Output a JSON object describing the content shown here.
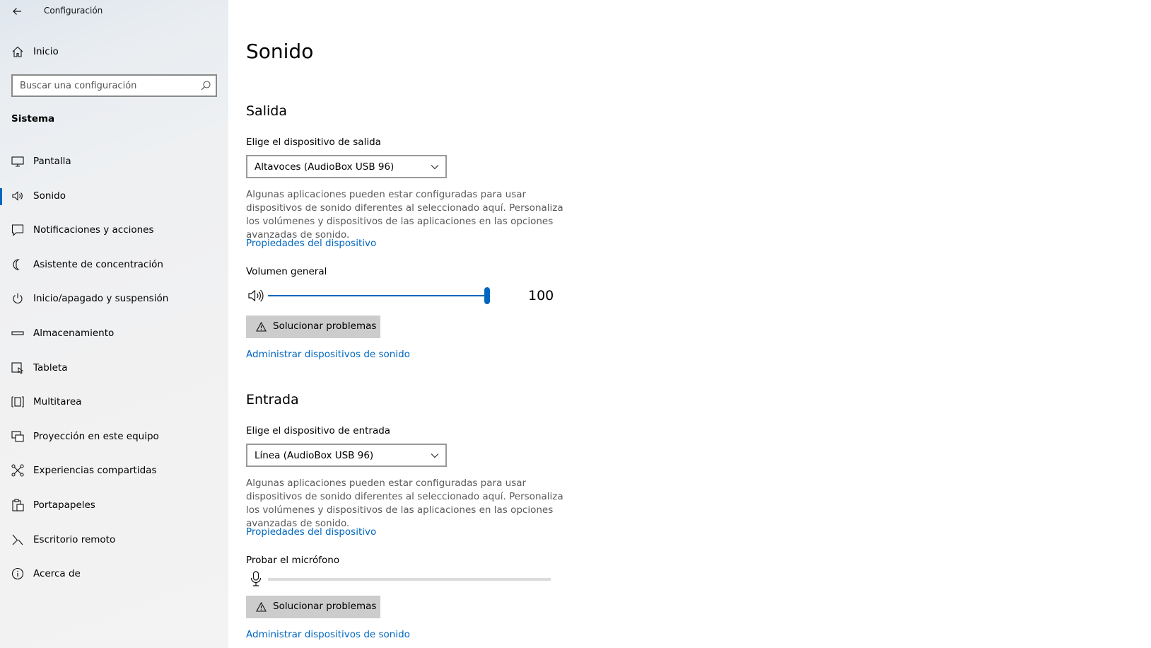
{
  "window": {
    "title": "Configuración"
  },
  "sidebar": {
    "home_label": "Inicio",
    "search_placeholder": "Buscar una configuración",
    "section": "Sistema",
    "items": [
      {
        "label": "Pantalla",
        "icon": "monitor-icon"
      },
      {
        "label": "Sonido",
        "icon": "speaker-icon",
        "active": true
      },
      {
        "label": "Notificaciones y acciones",
        "icon": "notification-icon"
      },
      {
        "label": "Asistente de concentración",
        "icon": "moon-icon"
      },
      {
        "label": "Inicio/apagado y suspensión",
        "icon": "power-icon"
      },
      {
        "label": "Almacenamiento",
        "icon": "storage-icon"
      },
      {
        "label": "Tableta",
        "icon": "tablet-icon"
      },
      {
        "label": "Multitarea",
        "icon": "multitask-icon"
      },
      {
        "label": "Proyección en este equipo",
        "icon": "projection-icon"
      },
      {
        "label": "Experiencias compartidas",
        "icon": "shared-icon"
      },
      {
        "label": "Portapapeles",
        "icon": "clipboard-icon"
      },
      {
        "label": "Escritorio remoto",
        "icon": "remote-desktop-icon"
      },
      {
        "label": "Acerca de",
        "icon": "info-icon"
      }
    ]
  },
  "main": {
    "title": "Sonido",
    "output": {
      "heading": "Salida",
      "device_label": "Elige el dispositivo de salida",
      "device_value": "Altavoces (AudioBox USB 96)",
      "description": "Algunas aplicaciones pueden estar configuradas para usar dispositivos de sonido diferentes al seleccionado aquí. Personaliza los volúmenes y dispositivos de las aplicaciones en las opciones avanzadas de sonido.",
      "properties_link": "Propiedades del dispositivo",
      "volume_label": "Volumen general",
      "volume_value": "100",
      "volume_level": 1.0,
      "troubleshoot": "Solucionar problemas",
      "manage_link": "Administrar dispositivos de sonido"
    },
    "input": {
      "heading": "Entrada",
      "device_label": "Elige el dispositivo de entrada",
      "device_value": "Línea (AudioBox USB 96)",
      "description": "Algunas aplicaciones pueden estar configuradas para usar dispositivos de sonido diferentes al seleccionado aquí. Personaliza los volúmenes y dispositivos de las aplicaciones en las opciones avanzadas de sonido.",
      "properties_link": "Propiedades del dispositivo",
      "mic_label": "Probar el micrófono",
      "mic_level": 0,
      "troubleshoot": "Solucionar problemas",
      "manage_link": "Administrar dispositivos de sonido"
    }
  },
  "colors": {
    "accent": "#0067c0",
    "sidebar_bg": "#f2f2f2",
    "button_bg": "#cccccc"
  }
}
